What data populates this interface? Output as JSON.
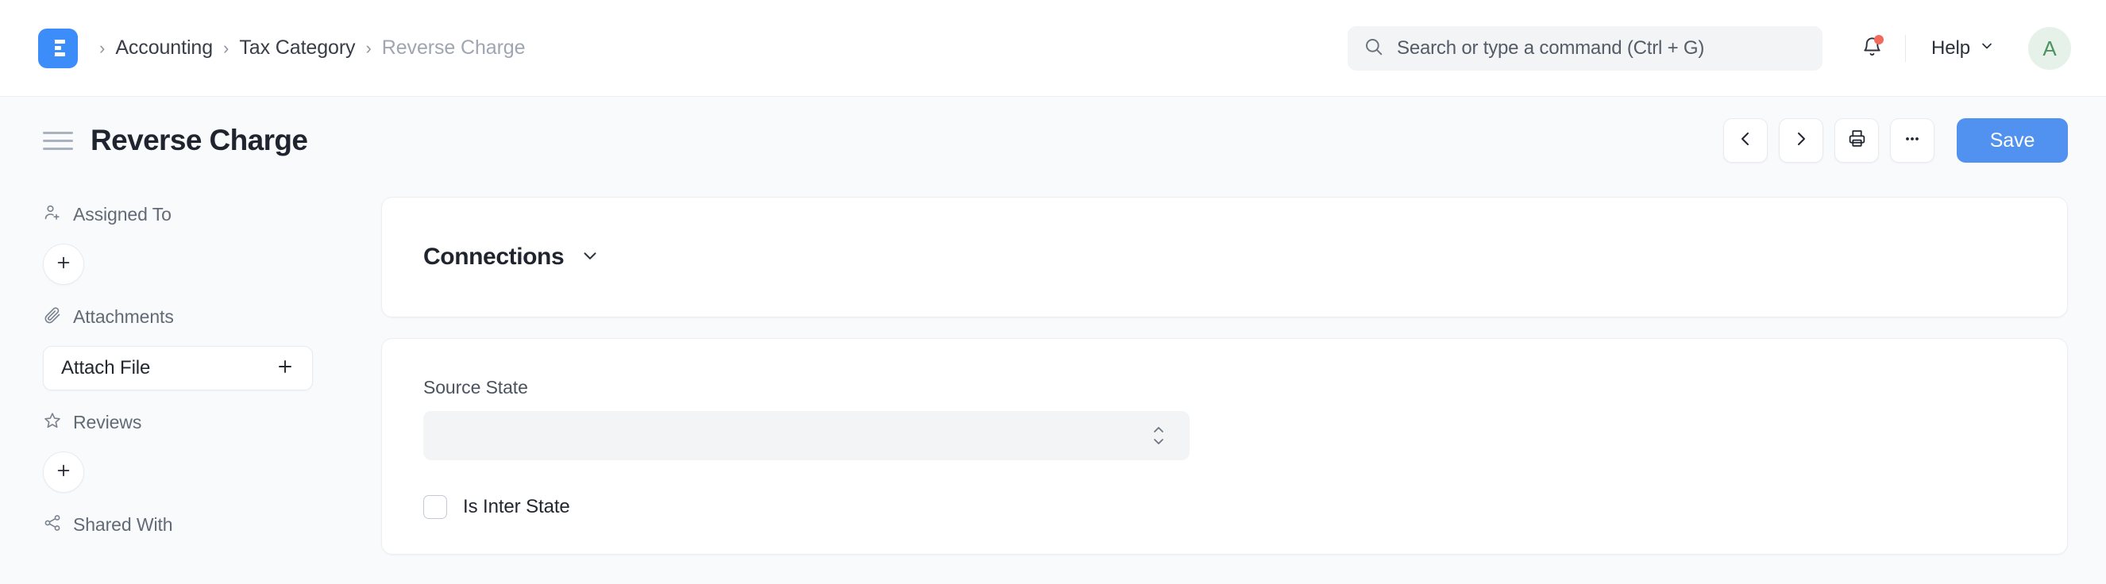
{
  "navbar": {
    "logo_alt": "ERPNext",
    "breadcrumb": [
      {
        "label": "Accounting",
        "current": false
      },
      {
        "label": "Tax Category",
        "current": false
      },
      {
        "label": "Reverse Charge",
        "current": true
      }
    ],
    "breadcrumb_separator": "›",
    "search": {
      "value": "",
      "placeholder": "Search or type a command (Ctrl + G)"
    },
    "notifications": {
      "has_unread": true
    },
    "help": {
      "label": "Help"
    },
    "avatar": {
      "initial": "A"
    }
  },
  "page_head": {
    "title": "Reverse Charge",
    "actions": {
      "prev_label": "",
      "next_label": "",
      "print_label": "",
      "more_label": "",
      "save_label": "Save"
    }
  },
  "sidebar": {
    "sections": [
      {
        "key": "assigned_to",
        "label": "Assigned To",
        "icon": "user-add-icon",
        "control": "plus-circle"
      },
      {
        "key": "attachments",
        "label": "Attachments",
        "icon": "paperclip-icon",
        "control": "attach-file",
        "attach_label": "Attach File"
      },
      {
        "key": "reviews",
        "label": "Reviews",
        "icon": "star-icon",
        "control": "plus-circle"
      },
      {
        "key": "shared_with",
        "label": "Shared With",
        "icon": "share-icon",
        "control": "none"
      }
    ]
  },
  "main": {
    "connections": {
      "title": "Connections",
      "collapsed": false
    },
    "form": {
      "fields": [
        {
          "key": "source_state",
          "label": "Source State",
          "type": "select",
          "value": "",
          "options": []
        },
        {
          "key": "is_inter_state",
          "label": "Is Inter State",
          "type": "checkbox",
          "checked": false
        }
      ]
    }
  },
  "colors": {
    "brand_blue": "#3c8dfa",
    "save_blue": "#5192f0",
    "page_bg": "#f8fafc",
    "card_bg": "#ffffff",
    "input_bg": "#f2f4f6",
    "text_primary": "#1f242e",
    "text_muted": "#8d95a0",
    "avatar_bg": "#e6f2e9",
    "avatar_fg": "#4b9460",
    "notification_dot": "#f16a5b"
  }
}
